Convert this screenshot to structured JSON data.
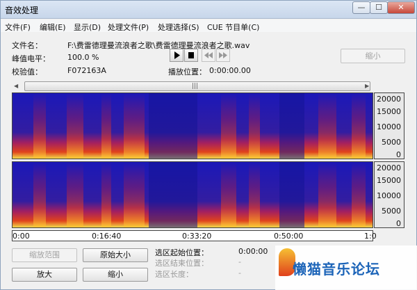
{
  "window": {
    "title": "音效处理",
    "min": "—",
    "max": "☐",
    "close": "✕"
  },
  "menu": [
    "文件(F)",
    "编辑(E)",
    "显示(D)",
    "处理文件(P)",
    "处理选择(S)",
    "CUE 节目单(C)"
  ],
  "info": {
    "file_label": "文件名：",
    "file_value": "F:\\费雷德理曼流浪者之歌\\费雷德理曼流浪者之歌.wav",
    "peak_label": "峰值电平：",
    "peak_value": "100.0 %",
    "checksum_label": "校验值：",
    "checksum_value": "F072163A",
    "playpos_label": "播放位置：",
    "playpos_value": "0:00:00.00",
    "shrink_label": "缩小"
  },
  "transport": {
    "play": "play-icon",
    "stop": "stop-icon",
    "rewind": "rewind-icon",
    "forward": "fast-forward-icon"
  },
  "scrollbar": {
    "left": "◀",
    "right": "▶",
    "grip": "|||"
  },
  "yaxis_ticks": [
    "20000",
    "15000",
    "10000",
    "5000",
    "0"
  ],
  "time_ticks": [
    "0:00",
    "0:16:40",
    "0:33:20",
    "0:50:00",
    "1:0"
  ],
  "buttons": {
    "zoom_range": "缩放范围",
    "original_size": "原始大小",
    "zoom_in": "放大",
    "zoom_out": "缩小"
  },
  "selection": {
    "start_label": "选区起始位置：",
    "start_value": "0:00:00",
    "end_label": "选区结束位置：",
    "end_value": "-",
    "length_label": "选区长度：",
    "length_value": "-"
  },
  "watermark": "懒猫音乐论坛"
}
